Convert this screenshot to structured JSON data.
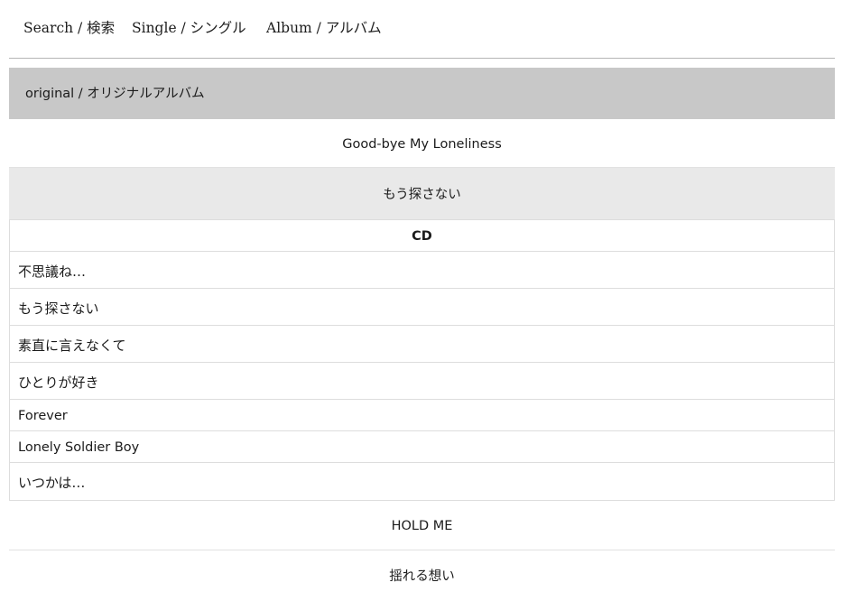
{
  "nav": {
    "search_label": "Search / 検索",
    "single_label": "Single / シングル",
    "album_label": "Album / アルバム"
  },
  "section": {
    "title": "original / オリジナルアルバム"
  },
  "albums": [
    {
      "title": "Good-bye My Loneliness"
    },
    {
      "title": "もう探さない"
    },
    {
      "title": "HOLD ME"
    },
    {
      "title": "揺れる想い"
    }
  ],
  "track_table": {
    "header": "CD",
    "tracks": [
      "不思議ね…",
      "もう探さない",
      "素直に言えなくて",
      "ひとりが好き",
      "Forever",
      "Lonely Soldier Boy",
      "いつかは…"
    ]
  },
  "colors": {
    "section_header_bg": "#c8c8c8",
    "selected_album_bg": "#e9e9e9",
    "divider": "#dddddd"
  }
}
